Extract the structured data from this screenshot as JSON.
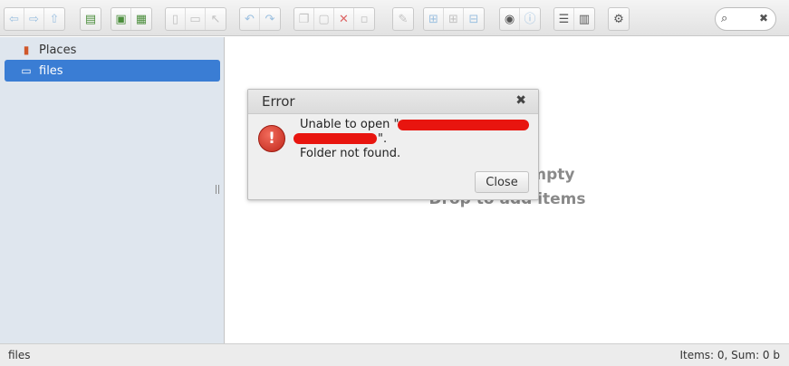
{
  "toolbar": {
    "groups": [
      [
        "arrow-left-icon",
        "arrow-right-icon",
        "arrow-up-icon"
      ],
      [
        "drive-icon"
      ],
      [
        "new-folder-icon",
        "save-icon"
      ],
      [
        "copy-file-icon",
        "floppy-icon",
        "cursor-icon"
      ],
      [
        "undo-icon",
        "redo-icon"
      ],
      [
        "duplicate-icon",
        "paste-icon",
        "delete-icon",
        "blank-icon"
      ],
      [
        "edit-icon"
      ],
      [
        "view-icons-icon",
        "view-small-icon",
        "view-tiles-icon"
      ],
      [
        "preview-eye-icon",
        "info-icon"
      ],
      [
        "list-view-icon",
        "columns-icon"
      ],
      [
        "settings-gear-icon"
      ]
    ],
    "search_icon": "magnifier-icon",
    "search_clear": "✖"
  },
  "sidebar": {
    "items": [
      {
        "label": "Places",
        "icon": "places-icon"
      },
      {
        "label": "files",
        "icon": "drive-icon"
      }
    ]
  },
  "content": {
    "empty_line1": "Folder is empty",
    "empty_line2": "Drop to add items"
  },
  "dialog": {
    "title": "Error",
    "close_x": "✖",
    "line1": "Unable to open \"",
    "line2": "\".",
    "line3": "Folder not found.",
    "close_label": "Close",
    "icon": "error-icon",
    "icon_glyph": "!"
  },
  "status": {
    "left": "files",
    "right": "Items: 0, Sum: 0 b"
  },
  "colors": {
    "selection": "#3a7dd4",
    "redaction": "#e8150f",
    "sidebar_bg": "#dfe6ee"
  }
}
